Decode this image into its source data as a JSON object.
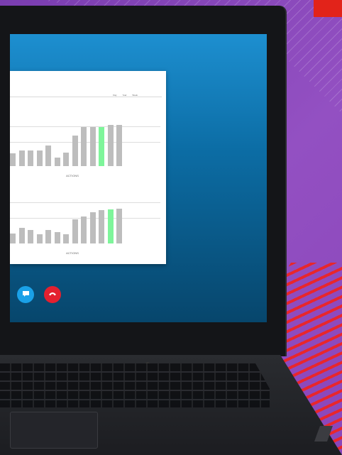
{
  "colors": {
    "highlight_bar": "#7ef59a",
    "bar": "#bdbdbd",
    "chat_button": "#1aa1e8",
    "end_call_button": "#e4202f"
  },
  "document": {
    "controls": [
      "Day",
      "Year",
      "Week"
    ],
    "charts": [
      {
        "caption": "ACTIONS",
        "values": [
          30,
          36,
          36,
          36,
          48,
          20,
          32,
          72,
          92,
          92,
          92,
          96,
          96
        ],
        "highlight_index": 10
      },
      {
        "caption": "ACTIONS",
        "values": [
          24,
          36,
          32,
          22,
          32,
          26,
          22,
          56,
          64,
          74,
          78,
          80,
          82
        ],
        "highlight_index": 11
      }
    ]
  },
  "call_controls": {
    "chat_icon": "chat-bubble-icon",
    "end_icon": "phone-hangup-icon"
  }
}
